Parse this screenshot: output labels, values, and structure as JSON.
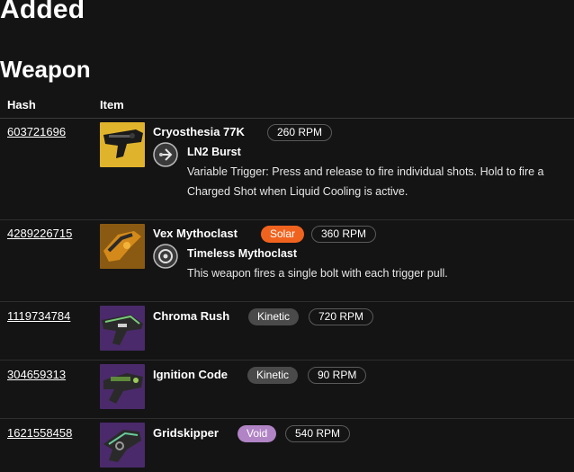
{
  "headings": {
    "added": "Added",
    "section": "Weapon"
  },
  "table": {
    "columns": [
      "Hash",
      "Item"
    ],
    "rows": [
      {
        "hash": "603721696",
        "name": "Cryosthesia 77K",
        "element": "",
        "rpm": "260 RPM",
        "perk": {
          "name": "LN2 Burst",
          "description": "Variable Trigger: Press and release to fire individual shots. Hold to fire a Charged Shot when Liquid Cooling is active."
        }
      },
      {
        "hash": "4289226715",
        "name": "Vex Mythoclast",
        "element": "Solar",
        "rpm": "360 RPM",
        "perk": {
          "name": "Timeless Mythoclast",
          "description": "This weapon fires a single bolt with each trigger pull."
        }
      },
      {
        "hash": "1119734784",
        "name": "Chroma Rush",
        "element": "Kinetic",
        "rpm": "720 RPM"
      },
      {
        "hash": "304659313",
        "name": "Ignition Code",
        "element": "Kinetic",
        "rpm": "90 RPM"
      },
      {
        "hash": "1621558458",
        "name": "Gridskipper",
        "element": "Void",
        "rpm": "540 RPM"
      }
    ]
  },
  "colors": {
    "background": "#141414",
    "solar": "#f0631f",
    "kinetic": "#4a4a4a",
    "void": "#b184c5"
  }
}
